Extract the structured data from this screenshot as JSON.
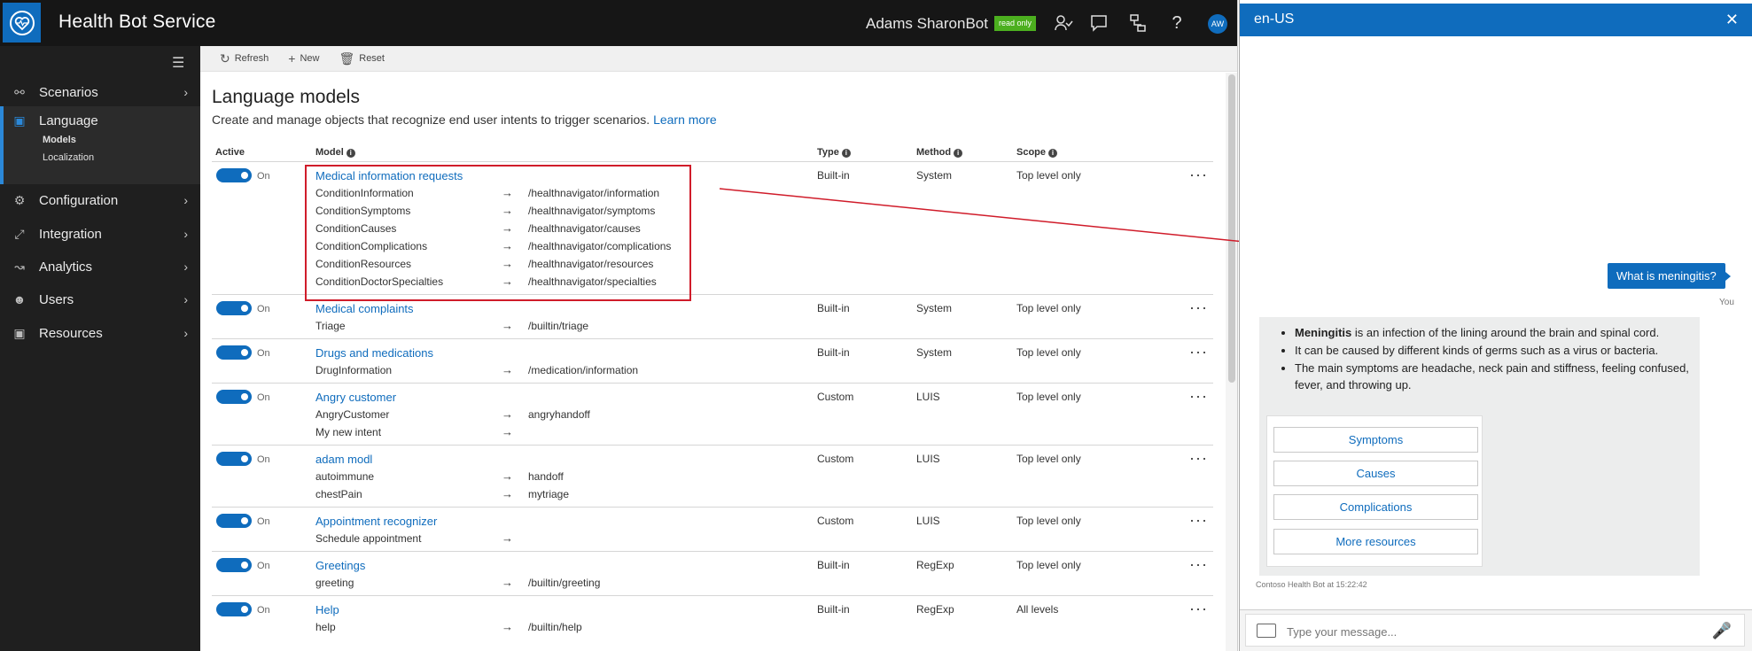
{
  "topbar": {
    "title": "Health Bot Service",
    "bot_name": "Adams SharonBot",
    "badge": "read only",
    "avatar": "AW",
    "icons": [
      "people-icon",
      "chat-icon",
      "flow-icon",
      "help-icon"
    ]
  },
  "sidebar": {
    "items": [
      {
        "label": "Scenarios",
        "icon": "scenarios-icon"
      },
      {
        "label": "Language",
        "icon": "language-icon"
      },
      {
        "label": "Configuration",
        "icon": "gear-icon"
      },
      {
        "label": "Integration",
        "icon": "integration-icon"
      },
      {
        "label": "Analytics",
        "icon": "chart-icon"
      },
      {
        "label": "Users",
        "icon": "users-icon"
      },
      {
        "label": "Resources",
        "icon": "image-icon"
      }
    ],
    "language_sub": [
      "Models",
      "Localization"
    ]
  },
  "toolbar": {
    "refresh": "Refresh",
    "new": "New",
    "reset": "Reset"
  },
  "page": {
    "title": "Language models",
    "subtitle": "Create and manage objects that recognize end user intents to trigger scenarios.",
    "learn_more": "Learn more"
  },
  "table": {
    "headers": {
      "active": "Active",
      "model": "Model",
      "type": "Type",
      "method": "Method",
      "scope": "Scope"
    },
    "toggle_label": "On",
    "arrow": "→",
    "rows": [
      {
        "name": "Medical information requests",
        "type": "Built-in",
        "method": "System",
        "scope": "Top level only",
        "intents": [
          {
            "intent": "ConditionInformation",
            "target": "/healthnavigator/information"
          },
          {
            "intent": "ConditionSymptoms",
            "target": "/healthnavigator/symptoms"
          },
          {
            "intent": "ConditionCauses",
            "target": "/healthnavigator/causes"
          },
          {
            "intent": "ConditionComplications",
            "target": "/healthnavigator/complications"
          },
          {
            "intent": "ConditionResources",
            "target": "/healthnavigator/resources"
          },
          {
            "intent": "ConditionDoctorSpecialties",
            "target": "/healthnavigator/specialties"
          }
        ]
      },
      {
        "name": "Medical complaints",
        "type": "Built-in",
        "method": "System",
        "scope": "Top level only",
        "intents": [
          {
            "intent": "Triage",
            "target": "/builtin/triage"
          }
        ]
      },
      {
        "name": "Drugs and medications",
        "type": "Built-in",
        "method": "System",
        "scope": "Top level only",
        "intents": [
          {
            "intent": "DrugInformation",
            "target": "/medication/information"
          }
        ]
      },
      {
        "name": "Angry customer",
        "type": "Custom",
        "method": "LUIS",
        "scope": "Top level only",
        "intents": [
          {
            "intent": "AngryCustomer",
            "target": "angryhandoff"
          },
          {
            "intent": "My new intent",
            "target": ""
          }
        ]
      },
      {
        "name": "adam modl",
        "type": "Custom",
        "method": "LUIS",
        "scope": "Top level only",
        "intents": [
          {
            "intent": "autoimmune",
            "target": "handoff"
          },
          {
            "intent": "chestPain",
            "target": "mytriage"
          }
        ]
      },
      {
        "name": "Appointment recognizer",
        "type": "Custom",
        "method": "LUIS",
        "scope": "Top level only",
        "intents": [
          {
            "intent": "Schedule appointment",
            "target": ""
          }
        ]
      },
      {
        "name": "Greetings",
        "type": "Built-in",
        "method": "RegExp",
        "scope": "Top level only",
        "intents": [
          {
            "intent": "greeting",
            "target": "/builtin/greeting"
          }
        ]
      },
      {
        "name": "Help",
        "type": "Built-in",
        "method": "RegExp",
        "scope": "All levels",
        "intents": [
          {
            "intent": "help",
            "target": "/builtin/help"
          }
        ]
      }
    ]
  },
  "chat": {
    "title": "en-US",
    "user_message": "What is meningitis?",
    "user_label": "You",
    "bot_bullets": [
      {
        "bold": "Meningitis",
        "text": " is an infection of the lining around the brain and spinal cord."
      },
      {
        "bold": "",
        "text": "It can be caused by different kinds of germs such as a virus or bacteria."
      },
      {
        "bold": "",
        "text": "The main symptoms are headache, neck pain and stiffness, feeling confused, fever, and throwing up."
      }
    ],
    "buttons": [
      "Symptoms",
      "Causes",
      "Complications",
      "More resources"
    ],
    "timestamp": "Contoso Health Bot at 15:22:42",
    "input_placeholder": "Type your message..."
  },
  "colors": {
    "accent": "#0f6cbd",
    "highlight": "#d01c2a",
    "badge": "#4caf1f"
  }
}
